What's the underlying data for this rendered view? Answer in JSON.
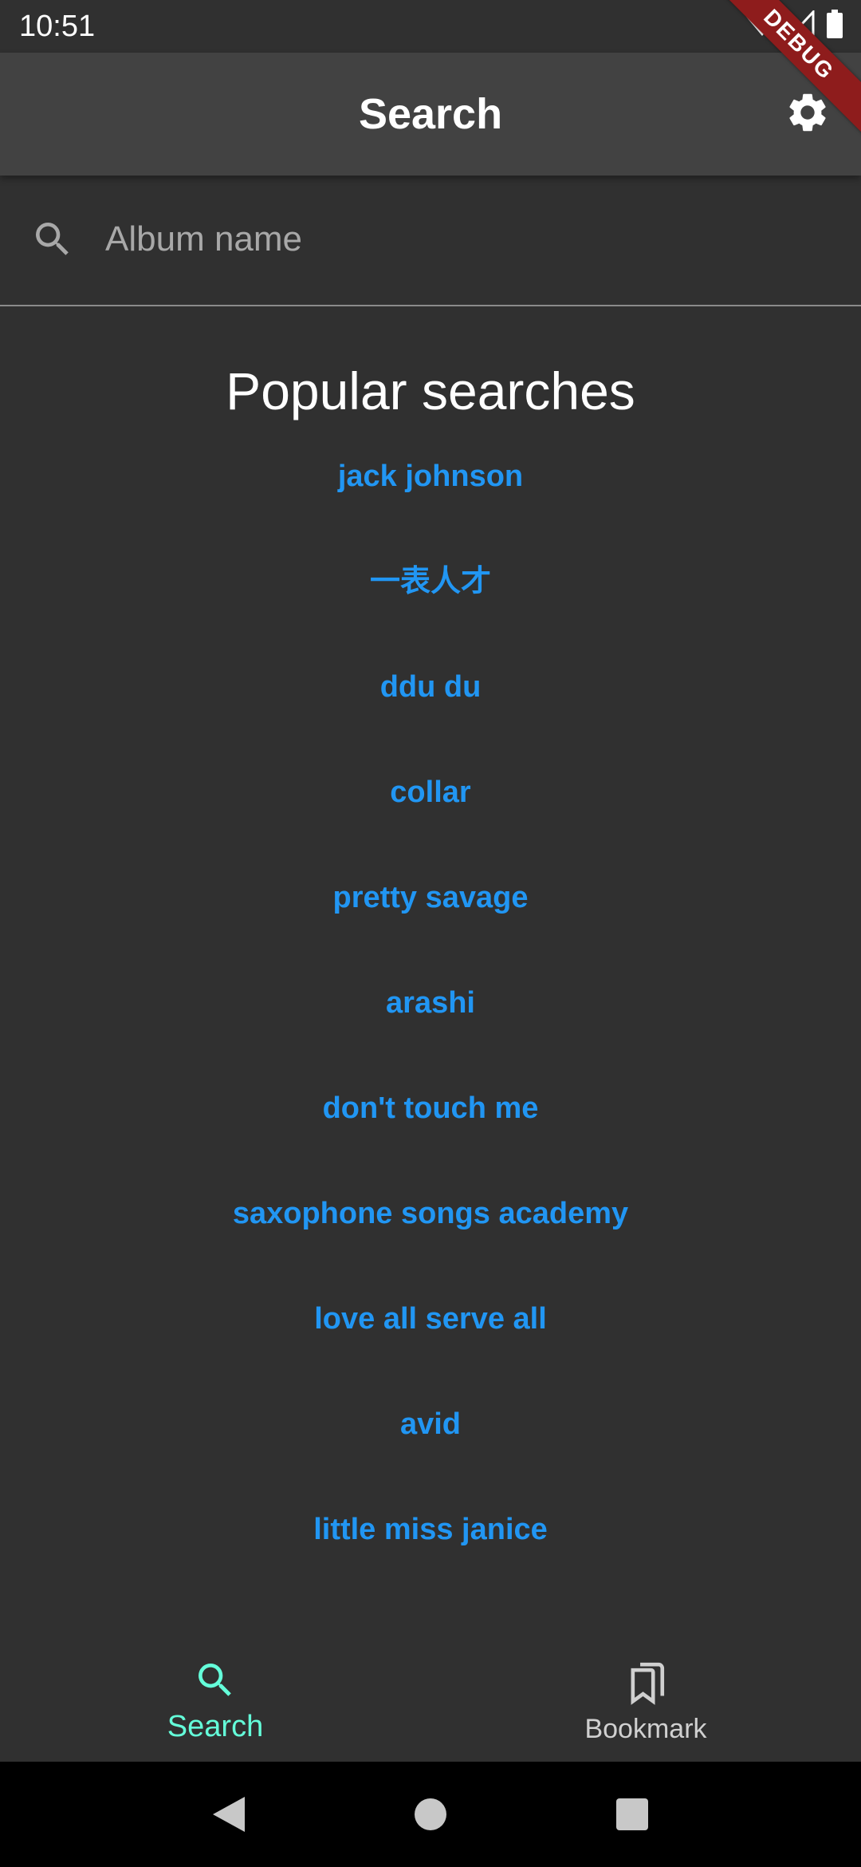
{
  "status_bar": {
    "time": "10:51",
    "debug_label": "DEBUG"
  },
  "app_bar": {
    "title": "Search",
    "settings_icon": "gear-icon"
  },
  "search": {
    "placeholder": "Album name",
    "value": "",
    "icon": "search-icon"
  },
  "popular": {
    "title": "Popular searches",
    "items": [
      "jack johnson",
      "一表人才",
      "ddu du",
      "collar",
      "pretty savage",
      "arashi",
      "don't touch me",
      "saxophone songs academy",
      "love all serve all",
      "avid",
      "little miss janice"
    ]
  },
  "bottom_nav": {
    "items": [
      {
        "label": "Search",
        "icon": "search-icon",
        "active": true
      },
      {
        "label": "Bookmark",
        "icon": "bookmark-icon",
        "active": false
      }
    ]
  },
  "colors": {
    "background": "#303030",
    "app_bar": "#424242",
    "link": "#2196f3",
    "active_nav": "#64ffda",
    "debug_banner": "#8e1c1c"
  }
}
